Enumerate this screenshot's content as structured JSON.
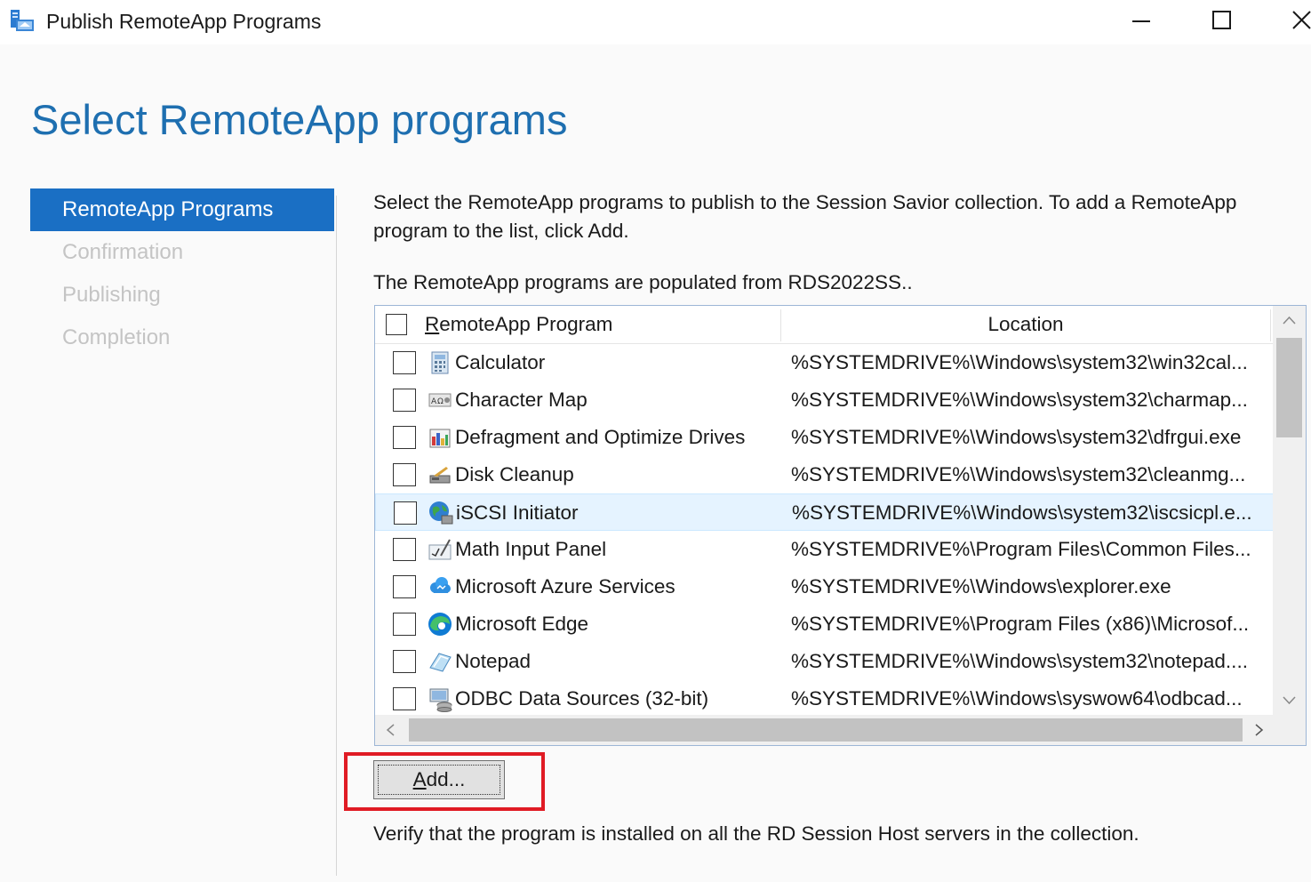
{
  "window": {
    "title": "Publish RemoteApp Programs",
    "icon": "remoteapp-publish-icon"
  },
  "page": {
    "title": "Select RemoteApp programs"
  },
  "nav": {
    "items": [
      {
        "label": "RemoteApp Programs",
        "active": true
      },
      {
        "label": "Confirmation",
        "active": false
      },
      {
        "label": "Publishing",
        "active": false
      },
      {
        "label": "Completion",
        "active": false
      }
    ]
  },
  "main": {
    "description": "Select the RemoteApp programs to publish to the Session Savior collection. To add a RemoteApp program to the list, click Add.",
    "source_note": "The RemoteApp programs are populated from RDS2022SS..",
    "list": {
      "col_program_prefix": "R",
      "col_program_rest": "emoteApp Program",
      "col_location": "Location",
      "rows": [
        {
          "name": "Calculator",
          "location": "%SYSTEMDRIVE%\\Windows\\system32\\win32cal...",
          "icon": "calculator-icon"
        },
        {
          "name": "Character Map",
          "location": "%SYSTEMDRIVE%\\Windows\\system32\\charmap...",
          "icon": "character-map-icon"
        },
        {
          "name": "Defragment and Optimize Drives",
          "location": "%SYSTEMDRIVE%\\Windows\\system32\\dfrgui.exe",
          "icon": "defragment-icon"
        },
        {
          "name": "Disk Cleanup",
          "location": "%SYSTEMDRIVE%\\Windows\\system32\\cleanmg...",
          "icon": "disk-cleanup-icon"
        },
        {
          "name": "iSCSI Initiator",
          "location": "%SYSTEMDRIVE%\\Windows\\system32\\iscsicpl.e...",
          "icon": "iscsi-initiator-icon"
        },
        {
          "name": "Math Input Panel",
          "location": "%SYSTEMDRIVE%\\Program Files\\Common Files...",
          "icon": "math-input-panel-icon"
        },
        {
          "name": "Microsoft Azure Services",
          "location": "%SYSTEMDRIVE%\\Windows\\explorer.exe",
          "icon": "azure-services-icon"
        },
        {
          "name": "Microsoft Edge",
          "location": "%SYSTEMDRIVE%\\Program Files (x86)\\Microsof...",
          "icon": "edge-icon"
        },
        {
          "name": "Notepad",
          "location": "%SYSTEMDRIVE%\\Windows\\system32\\notepad....",
          "icon": "notepad-icon"
        },
        {
          "name": "ODBC Data Sources (32-bit)",
          "location": "%SYSTEMDRIVE%\\Windows\\syswow64\\odbcad...",
          "icon": "odbc-icon"
        }
      ]
    },
    "add_button_prefix": "A",
    "add_button_rest": "dd...",
    "verify_note": "Verify that the program is installed on all the RD Session Host servers in the collection."
  },
  "colors": {
    "accent": "#1a6fc4",
    "title": "#1e6fb0",
    "highlight_box": "#e01b24",
    "row_hover": "#e5f3ff"
  }
}
